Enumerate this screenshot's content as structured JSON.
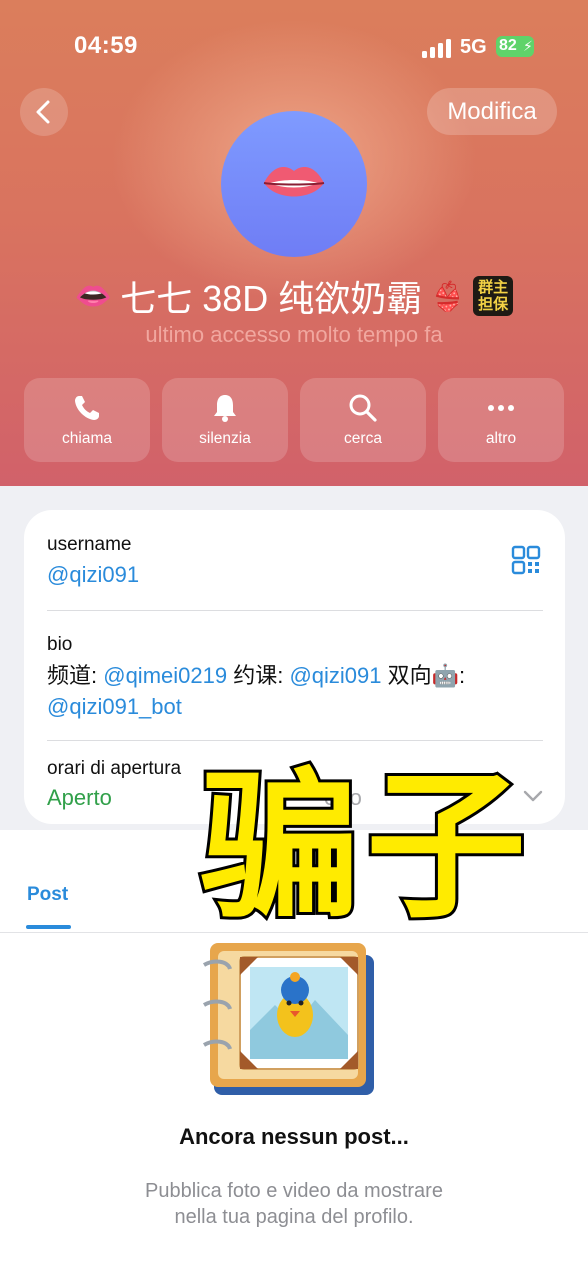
{
  "status_bar": {
    "time": "04:59",
    "network": "5G",
    "battery": "82"
  },
  "header": {
    "edit_label": "Modifica",
    "name_prefix_emoji": "👄",
    "name": "七七 38D 纯欲奶霸",
    "name_suffix_emoji": "👙",
    "badge_line1": "群主",
    "badge_line2": "担保",
    "last_seen": "ultimo accesso molto tempo fa"
  },
  "actions": [
    {
      "label": "chiama",
      "icon": "phone-icon"
    },
    {
      "label": "silenzia",
      "icon": "bell-icon"
    },
    {
      "label": "cerca",
      "icon": "search-icon"
    },
    {
      "label": "altro",
      "icon": "more-icon"
    }
  ],
  "info": {
    "username_label": "username",
    "username_value": "@qizi091",
    "bio_label": "bio",
    "bio_part1": "频道: ",
    "bio_link1": "@qimei0219",
    "bio_part2": " 约课: ",
    "bio_link2": "@qizi091",
    "bio_part3": " 双向",
    "bio_emoji": "🤖",
    "bio_part4": ": ",
    "bio_link3": "@qizi091_bot",
    "hours_label": "orari di apertura",
    "hours_status": "Aperto",
    "hours_right": "erto"
  },
  "tabs": {
    "post_label": "Post"
  },
  "overlay_text": "骗子",
  "empty": {
    "title": "Ancora nessun post...",
    "subtitle_line1": "Pubblica foto e video da mostrare",
    "subtitle_line2": "nella tua pagina del profilo."
  },
  "colors": {
    "accent": "#2a8bdb",
    "open_green": "#31a04a",
    "header_top": "#db7e5c",
    "header_bottom": "#d1616a"
  }
}
